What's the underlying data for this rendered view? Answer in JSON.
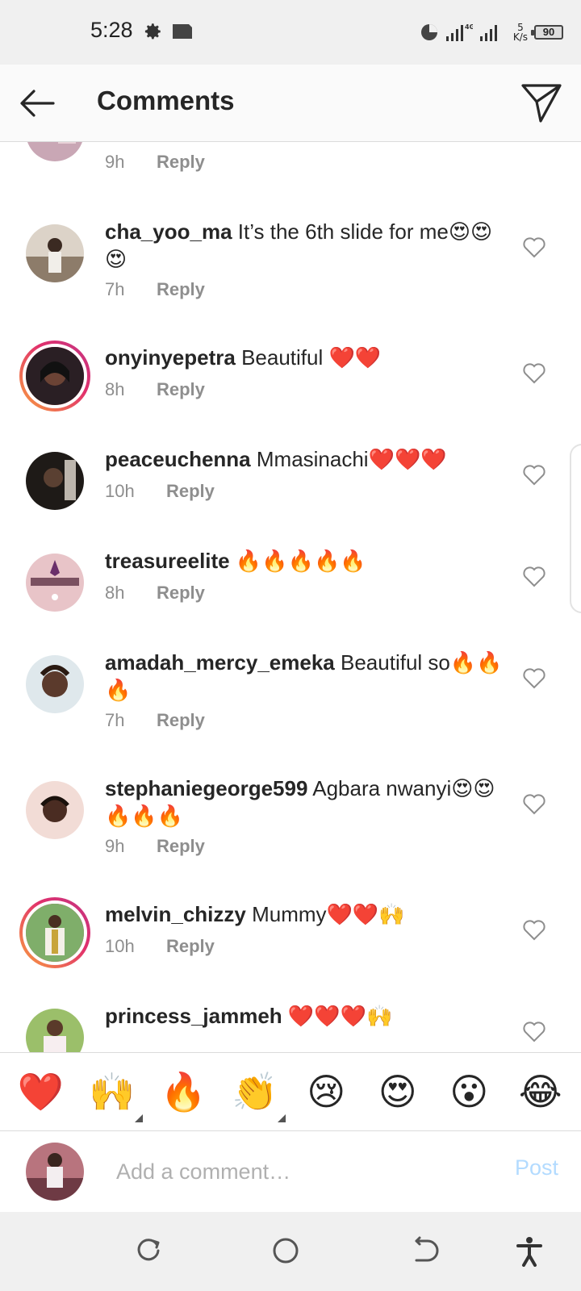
{
  "status_bar": {
    "time": "5:28",
    "network": "4G",
    "speed_value": "5",
    "speed_unit": "K/s",
    "battery": "90"
  },
  "header": {
    "title": "Comments"
  },
  "comments": [
    {
      "username": "",
      "text": "",
      "time": "9h",
      "reply": "Reply",
      "partial": true
    },
    {
      "username": "cha_yoo_ma",
      "text": "It’s the 6th slide for me😍😍😍",
      "time": "7h",
      "reply": "Reply"
    },
    {
      "username": "onyinyepetra",
      "text": "Beautiful ❤️❤️",
      "time": "8h",
      "reply": "Reply",
      "story_ring": true
    },
    {
      "username": "peaceuchenna",
      "text": "Mmasinachi❤️❤️❤️",
      "time": "10h",
      "reply": "Reply"
    },
    {
      "username": "treasureelite",
      "text": "🔥🔥🔥🔥🔥",
      "time": "8h",
      "reply": "Reply"
    },
    {
      "username": "amadah_mercy_emeka",
      "text": "Beautiful so🔥🔥🔥",
      "time": "7h",
      "reply": "Reply"
    },
    {
      "username": "stephaniegeorge599",
      "text": "Agbara nwanyi😍😍🔥🔥🔥",
      "time": "9h",
      "reply": "Reply"
    },
    {
      "username": "melvin_chizzy",
      "text": "Mummy❤️❤️🙌",
      "time": "10h",
      "reply": "Reply",
      "story_ring": true
    },
    {
      "username": "princess_jammeh",
      "text": "❤️❤️❤️🙌",
      "time": "",
      "reply": "",
      "partial": true
    }
  ],
  "emoji_bar": [
    "❤️",
    "🙌",
    "🔥",
    "👏",
    "😢",
    "😍",
    "😮",
    "😂"
  ],
  "composer": {
    "placeholder": "Add a comment…",
    "post_label": "Post"
  },
  "colors": {
    "link_disabled": "#b3dbff",
    "meta_gray": "#8e8e8e",
    "story_ring_start": "#f9a03f",
    "story_ring_end": "#c13584",
    "heart_red": "#ed4956"
  }
}
